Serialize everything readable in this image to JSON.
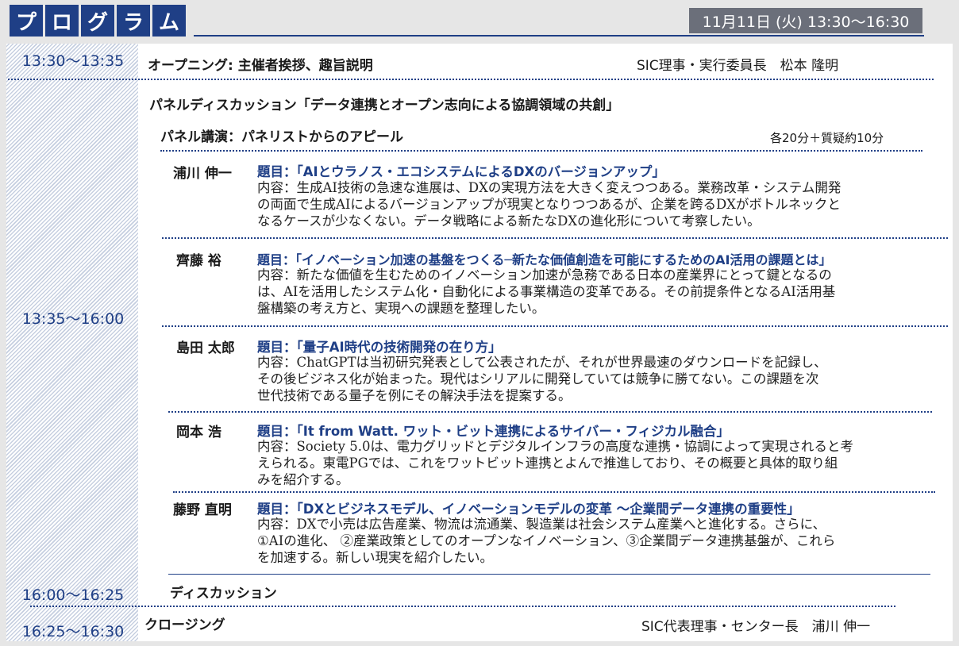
{
  "header": {
    "title_chars": [
      "プ",
      "ロ",
      "グ",
      "ラ",
      "ム"
    ],
    "date_time": "11月11日 (火) 13:30〜16:30"
  },
  "colors": {
    "accent": "#1f3f86",
    "date_bg": "#6b6f7a"
  },
  "opening": {
    "time": "13:30〜13:35",
    "title": "オープニング: 主催者挨拶、趣旨説明",
    "speaker": "SIC理事・実行委員長　松本 隆明"
  },
  "panel": {
    "time": "13:35〜16:00",
    "title": "パネルディスカッション「データ連携とオープン志向による協調領域の共創」",
    "subtitle": "パネル講演：パネリストからのアピール",
    "format": "各20分＋質疑約10分",
    "talks": [
      {
        "name": "浦川 伸一",
        "topic": "題目：「AIとウラノス・エコシステムによるDXのバージョンアップ」",
        "desc": [
          "内容：生成AI技術の急速な進展は、DXの実現方法を大きく変えつつある。業務改革・システム開発",
          "の両面で生成AIによるバージョンアップが現実となりつつあるが、企業を跨るDXがボトルネックと",
          "なるケースが少なくない。データ戦略による新たなDXの進化形について考察したい。"
        ]
      },
      {
        "name": "齊藤 裕",
        "topic": "題目：「イノベーション加速の基盤をつくる─新たな価値創造を可能にするためのAI活用の課題とは」",
        "desc": [
          "内容：新たな価値を生むためのイノベーション加速が急務である日本の産業界にとって鍵となるの",
          "は、AIを活用したシステム化・自動化による事業構造の変革である。その前提条件となるAI活用基",
          "盤構築の考え方と、実現への課題を整理したい。"
        ]
      },
      {
        "name": "島田 太郎",
        "topic": "題目：「量子AI時代の技術開発の在り方」",
        "desc": [
          "内容：ChatGPTは当初研究発表として公表されたが、それが世界最速のダウンロードを記録し、",
          "その後ビジネス化が始まった。現代はシリアルに開発していては競争に勝てない。この課題を次",
          "世代技術である量子を例にその解決手法を提案する。"
        ]
      },
      {
        "name": "岡本 浩",
        "topic": "題目：「It from Watt. ワット・ビット連携によるサイバー・フィジカル融合」",
        "desc": [
          "内容：Society 5.0は、電力グリッドとデジタルインフラの高度な連携・協調によって実現されると考",
          "えられる。東電PGでは、これをワットビット連携とよんで推進しており、その概要と具体的取り組",
          "みを紹介する。"
        ]
      },
      {
        "name": "藤野 直明",
        "topic": "題目：「DXとビジネスモデル、イノベーションモデルの変革 〜企業間データ連携の重要性」",
        "desc": [
          "内容：DXで小売は広告産業、物流は流通業、製造業は社会システム産業へと進化する。さらに、",
          "①AIの進化、 ②産業政策としてのオープンなイノベーション、③企業間データ連携基盤が、これら",
          "を加速する。新しい現実を紹介したい。"
        ]
      }
    ]
  },
  "discussion": {
    "time": "16:00〜16:25",
    "title": "ディスカッション"
  },
  "closing": {
    "time": "16:25〜16:30",
    "title": "クロージング",
    "speaker": "SIC代表理事・センター長　浦川 伸一"
  }
}
